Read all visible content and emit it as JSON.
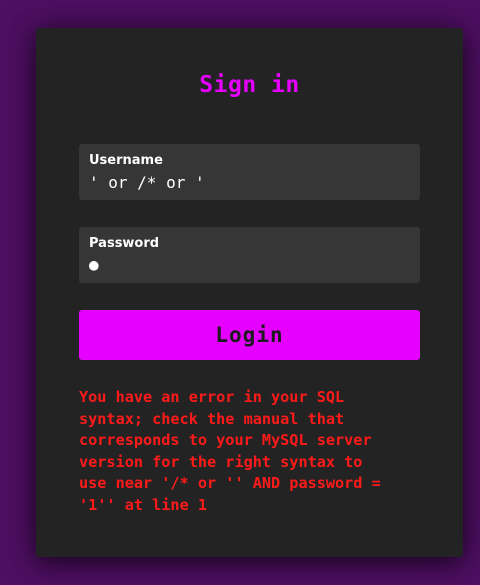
{
  "form": {
    "title": "Sign in",
    "username_label": "Username",
    "username_value": "' or /* or '",
    "password_label": "Password",
    "password_value": "●",
    "login_label": "Login"
  },
  "error": {
    "message": "You have an error in your SQL\nsyntax; check the manual that\ncorresponds to your MySQL server\nversion for the right syntax to\nuse near '/* or '' AND password =\n'1'' at line 1"
  },
  "colors": {
    "page_background": "#4f0f63",
    "card_background": "#232323",
    "field_background": "#363636",
    "accent": "#e600ff",
    "error": "#ff1a1a"
  }
}
